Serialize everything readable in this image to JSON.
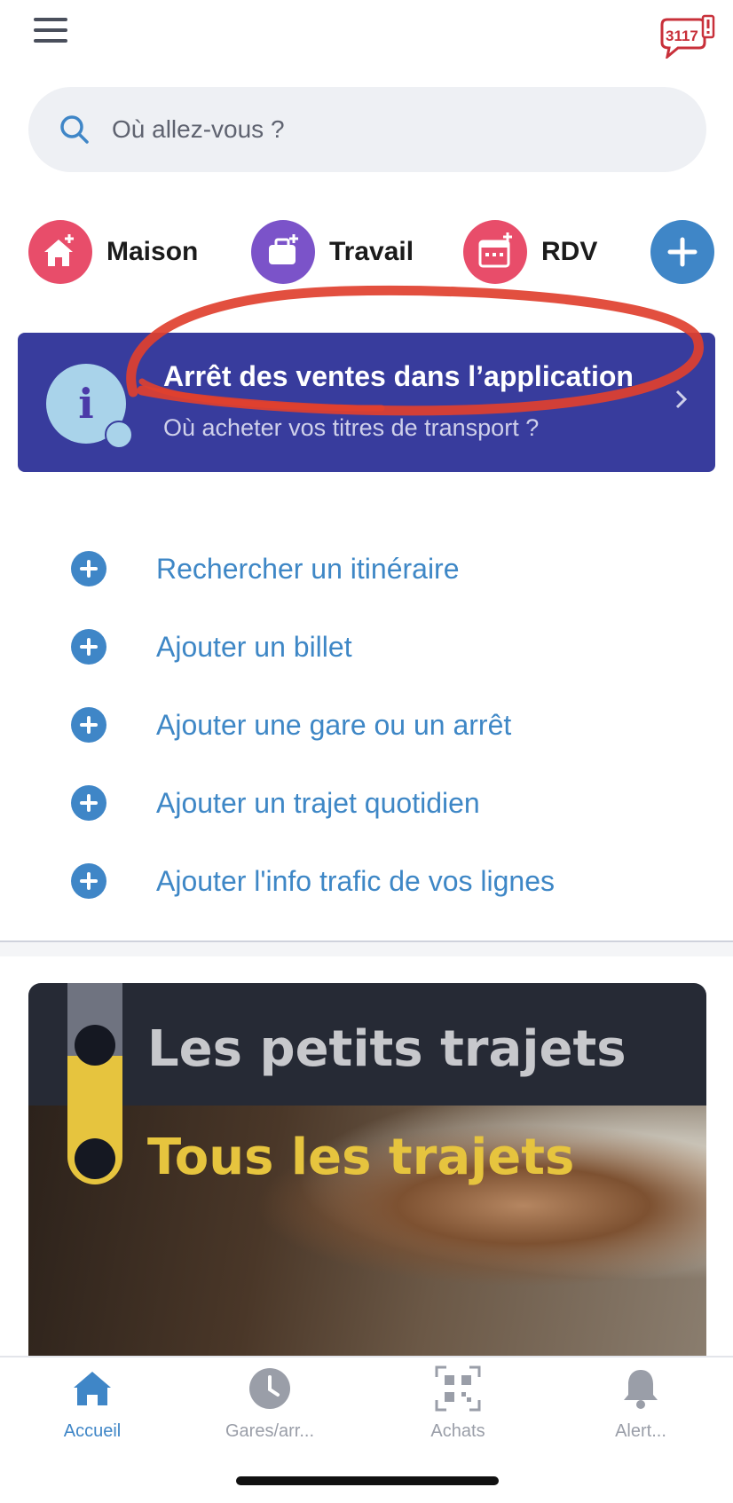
{
  "header": {
    "menu_icon": "hamburger-menu-icon",
    "help_badge": "3117"
  },
  "search": {
    "placeholder": "Où allez-vous ?"
  },
  "shortcuts": [
    {
      "label": "Maison",
      "color": "#e84d6a",
      "icon": "home-plus-icon"
    },
    {
      "label": "Travail",
      "color": "#7b53c9",
      "icon": "briefcase-plus-icon"
    },
    {
      "label": "RDV",
      "color": "#e84d6a",
      "icon": "calendar-plus-icon"
    },
    {
      "label": "",
      "color": "#3f86c7",
      "icon": "plus-icon"
    }
  ],
  "banner": {
    "title": "Arrêt des ventes dans l’application",
    "subtitle": "Où acheter vos titres de transport ?",
    "background": "#383c9d",
    "annotation_color": "#e0402f"
  },
  "actions": [
    {
      "label": "Rechercher un itinéraire"
    },
    {
      "label": "Ajouter un billet"
    },
    {
      "label": "Ajouter une gare ou un arrêt"
    },
    {
      "label": "Ajouter un trajet quotidien"
    },
    {
      "label": "Ajouter l'info trafic de vos lignes"
    }
  ],
  "promo": {
    "line1": "Les petits trajets",
    "line2": "Tous les trajets"
  },
  "tabbar": {
    "items": [
      {
        "label": "Accueil",
        "icon": "home-icon",
        "active": true
      },
      {
        "label": "Gares/arr...",
        "icon": "clock-icon",
        "active": false
      },
      {
        "label": "Achats",
        "icon": "qr-code-icon",
        "active": false
      },
      {
        "label": "Alert...",
        "icon": "bell-icon",
        "active": false
      }
    ],
    "active_color": "#3f86c7",
    "inactive_color": "#9a9ea8"
  }
}
